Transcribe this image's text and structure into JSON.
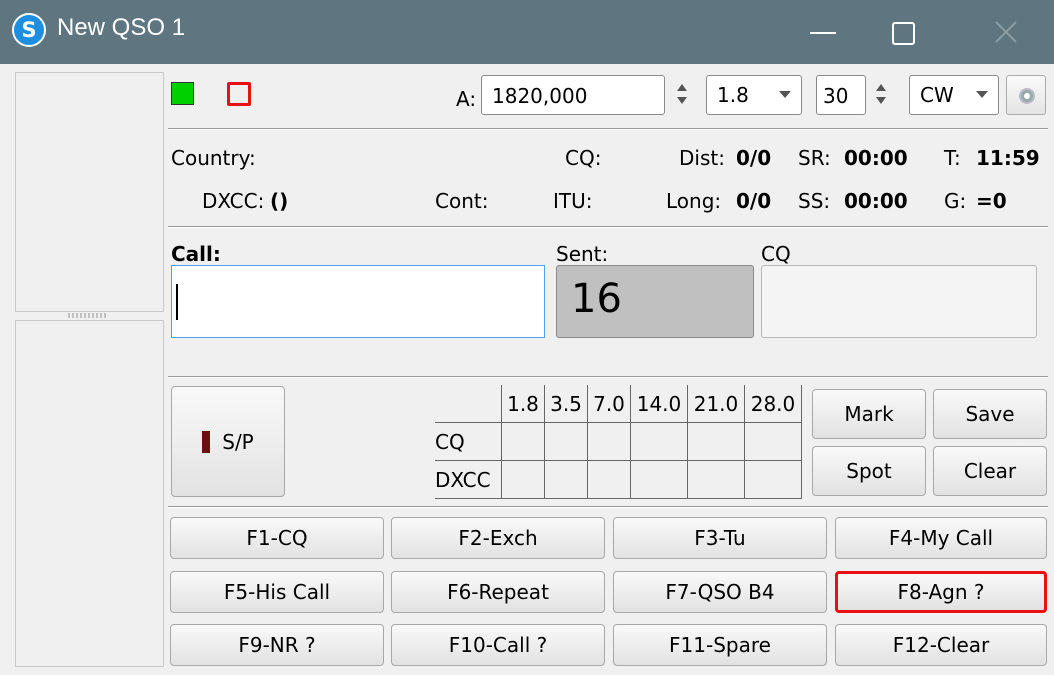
{
  "window": {
    "title": "New QSO 1",
    "app_icon_letter": "S"
  },
  "frequency": {
    "label": "A:",
    "value": "1820,000"
  },
  "band": {
    "selected": "1.8"
  },
  "power": {
    "value": "30"
  },
  "mode": {
    "selected": "CW"
  },
  "info": {
    "country_label": "Country:",
    "cq_label": "CQ:",
    "dist_label": "Dist:",
    "dist_value": "0/0",
    "sr_label": "SR:",
    "sr_value": "00:00",
    "t_label": "T:",
    "t_value": "11:59",
    "dxcc_label": "DXCC:",
    "dxcc_value": "()",
    "cont_label": "Cont:",
    "itu_label": "ITU:",
    "long_label": "Long:",
    "long_value": "0/0",
    "ss_label": "SS:",
    "ss_value": "00:00",
    "g_label": "G:",
    "g_value": "=0"
  },
  "entry": {
    "call_label": "Call:",
    "call_value": "",
    "sent_label": "Sent:",
    "sent_value": "16",
    "cq_label": "CQ",
    "cq_value": ""
  },
  "sp_button": {
    "label": "S/P",
    "indicator_color": "#6b1010"
  },
  "band_table": {
    "columns": [
      "1.8",
      "3.5",
      "7.0",
      "14.0",
      "21.0",
      "28.0"
    ],
    "rows": [
      "CQ",
      "DXCC"
    ]
  },
  "actions": {
    "mark": "Mark",
    "save": "Save",
    "spot": "Spot",
    "clear": "Clear"
  },
  "fkeys": [
    "F1-CQ",
    "F2-Exch",
    "F3-Tu",
    "F4-My Call",
    "F5-His Call",
    "F6-Repeat",
    "F7-QSO B4",
    "F8-Agn ?",
    "F9-NR ?",
    "F10-Call ?",
    "F11-Spare",
    "F12-Clear"
  ],
  "colors": {
    "titlebar": "#5f7680",
    "indicator_green": "#00d000",
    "indicator_red": "#e81010",
    "highlight": "#e81010"
  }
}
